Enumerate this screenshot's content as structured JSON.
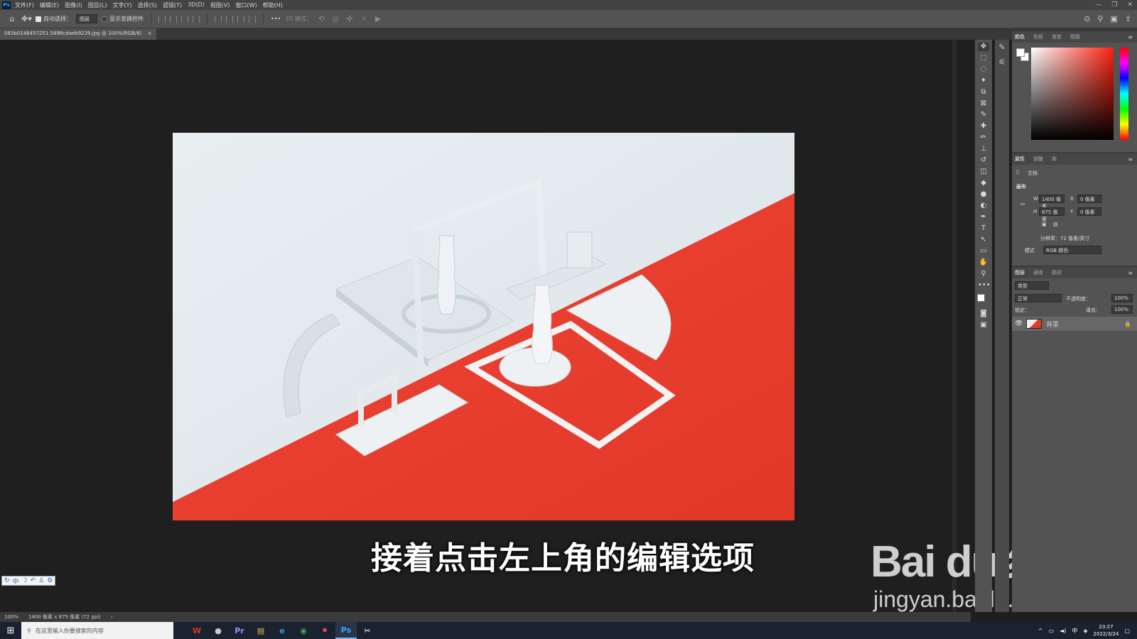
{
  "app": {
    "logo": "Ps"
  },
  "menubar": {
    "items": [
      "文件(F)",
      "编辑(E)",
      "图像(I)",
      "图层(L)",
      "文字(Y)",
      "选择(S)",
      "滤镜(T)",
      "3D(D)",
      "视图(V)",
      "窗口(W)",
      "帮助(H)"
    ],
    "window_controls": [
      "—",
      "❐",
      "✕"
    ]
  },
  "options_bar": {
    "auto_select_label": "自动选择：",
    "auto_select_checked": true,
    "target_select": "图层",
    "show_transform_label": "显示变换控件",
    "show_transform_checked": false,
    "more": "•••",
    "mode_3d_label": "3D 模式："
  },
  "document": {
    "tab_title": "083b0148457251.5898cdaeb9239.jpg @ 100%(RGB/8)",
    "tab_close": "×",
    "zoom": "100%",
    "status_info": "1400 像素 x 875 像素 (72 ppi)",
    "status_arrow": "›"
  },
  "subtitle": "接着点击左上角的编辑选项",
  "watermark": {
    "logo": "Bai du 经验",
    "url": "jingyan.baidu.com"
  },
  "ime_bar": {
    "items": [
      "↻",
      "中",
      "☽",
      "↶",
      "♙",
      "⚙"
    ]
  },
  "tools": [
    "move-icon",
    "marquee-icon",
    "lasso-icon",
    "magic-wand-icon",
    "crop-icon",
    "frame-icon",
    "eyedropper-icon",
    "healing-icon",
    "brush-icon",
    "stamp-icon",
    "history-brush-icon",
    "eraser-icon",
    "bucket-icon",
    "blur-icon",
    "dodge-icon",
    "pen-icon",
    "type-icon",
    "path-select-icon",
    "rectangle-icon",
    "hand-icon",
    "zoom-icon",
    "more-icon"
  ],
  "tool_glyphs": [
    "✥",
    "⬚",
    "◌",
    "✦",
    "⧉",
    "⊠",
    "✎",
    "✚",
    "✏",
    "⊥",
    "↺",
    "◫",
    "◆",
    "●",
    "◐",
    "✒",
    "T",
    "↖",
    "▭",
    "✋",
    "⚲",
    "•••"
  ],
  "color_panel": {
    "tabs": [
      "颜色",
      "色板",
      "渐变",
      "图案"
    ],
    "active_tab": 0,
    "foreground": "#ffffff",
    "background": "#ffffff"
  },
  "properties_panel": {
    "tabs": [
      "属性",
      "调整",
      "库"
    ],
    "active_tab": 0,
    "doc_label": "文档",
    "section": "画布",
    "w_label": "W",
    "w_value": "1400 像素",
    "h_label": "H",
    "h_value": "875 像素",
    "x_label": "X",
    "x_placeholder": "0 像素",
    "y_label": "Y",
    "y_placeholder": "0 像素",
    "resolution": "分辨率：72 像素/英寸",
    "mode_label": "模式",
    "mode_value": "RGB 颜色"
  },
  "layers_panel": {
    "tabs": [
      "图层",
      "通道",
      "路径"
    ],
    "active_tab": 0,
    "search_placeholder": "类型",
    "blend_mode": "正常",
    "opacity_label": "不透明度：",
    "opacity_value": "100%",
    "lock_label": "锁定：",
    "fill_label": "填充：",
    "fill_value": "100%",
    "layers": [
      {
        "name": "背景",
        "visible": true,
        "locked": true
      }
    ]
  },
  "taskbar": {
    "search_placeholder": "在这里输入你要搜索的内容",
    "apps": [
      "W",
      "●",
      "Pr",
      "▤",
      "e",
      "◉",
      "⏺",
      "Ps",
      "✂"
    ],
    "app_colors": [
      "#d9372b",
      "#cccccc",
      "#9b8cff",
      "#f0c040",
      "#2fa0e8",
      "#3aa65d",
      "#e84a3a",
      "#31a8ff",
      "#ffffff"
    ],
    "time": "23:27",
    "date": "2022/3/24",
    "lang": "中"
  }
}
